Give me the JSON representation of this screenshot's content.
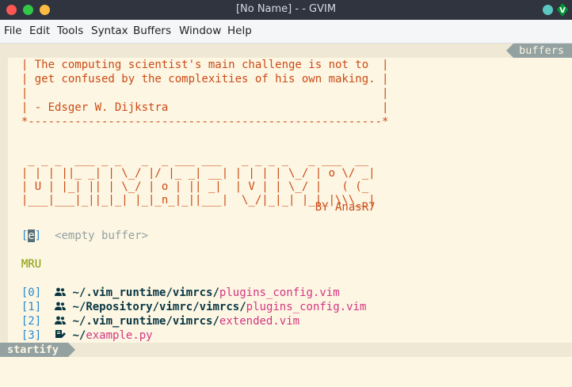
{
  "window": {
    "title": "[No Name] - - GVIM",
    "colors": {
      "close": "#fc5753",
      "minimize": "#fdbc40",
      "maximize": "#33c748",
      "accent": "#5cc6c0"
    }
  },
  "menu": {
    "items": [
      "File",
      "Edit",
      "Tools",
      "Syntax",
      "Buffers",
      "Window",
      "Help"
    ]
  },
  "tabline": {
    "label": "buffers"
  },
  "quote": [
    "  | The computing scientist's main challenge is not to  |",
    "  | get confused by the complexities of his own making. |",
    "  |                                                     |",
    "  | - Edsger W. Dijkstra                                |",
    "  *-----------------------------------------------------*"
  ],
  "banner": [
    "   _ _ _  ___ _ _   _  _ ___ ___   _ _ _ _   _ ___  __",
    "  | | | ||_ _| | \\_/ |/ |_ _| __| | | | | \\_/ | o \\/ _|",
    "  | U | |_| || | \\_/ | o | || _|  | V | | \\_/ |   ( (_",
    "  |___|___|_||_|_| |_|_n_|_||___|  \\_/|_|_| |_|_|\\\\\\__|"
  ],
  "byline": "                                              BY AnasR7",
  "empty_buffer": {
    "key_open": "  [",
    "key": "e",
    "key_close": "]",
    "label": "<empty buffer>"
  },
  "mru": {
    "header": "  MRU",
    "items": [
      {
        "index": "[0]",
        "prefix": "~/",
        "bold_parts": [
          ".vim_runtime",
          "vimrcs"
        ],
        "file": "plugins_config.vim"
      },
      {
        "index": "[1]",
        "prefix": "~/",
        "bold_parts": [
          "Repository",
          "vimrc",
          "vimrcs"
        ],
        "file": "plugins_config.vim"
      },
      {
        "index": "[2]",
        "prefix": "~/",
        "bold_parts": [
          ".vim_runtime",
          "vimrcs"
        ],
        "file": "extended.vim"
      },
      {
        "index": "[3]",
        "prefix": "~/",
        "bold_parts": [],
        "file": "example.py"
      }
    ],
    "icons": [
      "users-icon",
      "users-icon",
      "users-icon",
      "file-edit-icon"
    ]
  },
  "statusline": {
    "mode": "startify"
  },
  "colors": {
    "background": "#fdf6e3",
    "quote": "#cb4b16",
    "index": "#268bd2",
    "filename": "#d33682",
    "mru_header": "#859900"
  }
}
